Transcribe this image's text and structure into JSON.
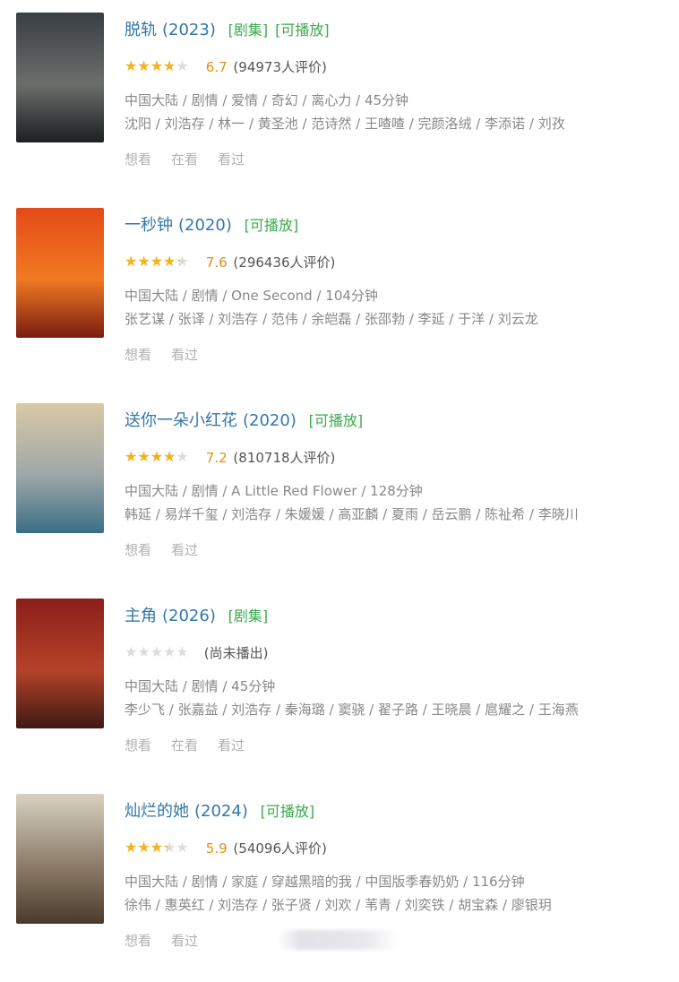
{
  "items": [
    {
      "title": "脱轨",
      "year": "(2023)",
      "badges": [
        "[剧集]",
        "[可播放]"
      ],
      "rating_fraction": 0.67,
      "score": "6.7",
      "votes": "(94973人评价)",
      "meta": "中国大陆 / 剧情 / 爱情 / 奇幻 / 离心力 / 45分钟",
      "cast": "沈阳 / 刘浩存 / 林一 / 黄圣池 / 范诗然 / 王喳喳 / 完颜洛绒 / 李添诺 / 刘孜",
      "actions": [
        "想看",
        "在看",
        "看过"
      ],
      "poster": {
        "tag": "",
        "caption": "",
        "colors": [
          "#3a3f44",
          "#6b6e6a",
          "#1d2022"
        ]
      }
    },
    {
      "title": "一秒钟",
      "year": "(2020)",
      "badges": [
        "[可播放]"
      ],
      "rating_fraction": 0.76,
      "score": "7.6",
      "votes": "(296436人评价)",
      "meta": "中国大陆 / 剧情 / One Second / 104分钟",
      "cast": "张艺谋 / 张译 / 刘浩存 / 范伟 / 余皑磊 / 张邵勃 / 李延 / 于洋 / 刘云龙",
      "actions": [
        "想看",
        "看过"
      ],
      "poster": {
        "tag": "",
        "caption": "",
        "colors": [
          "#e44a1a",
          "#f07a22",
          "#7a1c10"
        ]
      }
    },
    {
      "title": "送你一朵小红花",
      "year": "(2020)",
      "badges": [
        "[可播放]"
      ],
      "rating_fraction": 0.72,
      "score": "7.2",
      "votes": "(810718人评价)",
      "meta": "中国大陆 / 剧情 / A Little Red Flower / 128分钟",
      "cast": "韩延 / 易烊千玺 / 刘浩存 / 朱媛媛 / 高亚麟 / 夏雨 / 岳云鹏 / 陈祉希 / 李晓川",
      "actions": [
        "想看",
        "看过"
      ],
      "poster": {
        "tag": "",
        "caption": "",
        "colors": [
          "#d9c9a6",
          "#9fa7a8",
          "#3a6f86"
        ]
      }
    },
    {
      "title": "主角",
      "year": "(2026)",
      "badges": [
        "[剧集]"
      ],
      "rating_fraction": 0,
      "score": "",
      "votes": "(尚未播出)",
      "meta": "中国大陆 / 剧情 / 45分钟",
      "cast": "李少飞 / 张嘉益 / 刘浩存 / 秦海璐 / 窦骁 / 翟子路 / 王晓晨 / 扈耀之 / 王海燕",
      "actions": [
        "想看",
        "在看",
        "看过"
      ],
      "poster": {
        "tag": "",
        "caption": "",
        "colors": [
          "#8a1f1a",
          "#b5432a",
          "#3d1a12"
        ]
      }
    },
    {
      "title": "灿烂的她",
      "year": "(2024)",
      "badges": [
        "[可播放]"
      ],
      "rating_fraction": 0.59,
      "score": "5.9",
      "votes": "(54096人评价)",
      "meta": "中国大陆 / 剧情 / 家庭 / 穿越黑暗的我 / 中国版季春奶奶 / 116分钟",
      "cast": "徐伟 / 惠英红 / 刘浩存 / 张子贤 / 刘欢 / 苇青 / 刘奕铁 / 胡宝森 / 廖银玥",
      "actions": [
        "想看",
        "看过"
      ],
      "poster": {
        "tag": "",
        "caption": "",
        "colors": [
          "#d8d2c2",
          "#8c7c68",
          "#4a3a2c"
        ]
      }
    }
  ]
}
